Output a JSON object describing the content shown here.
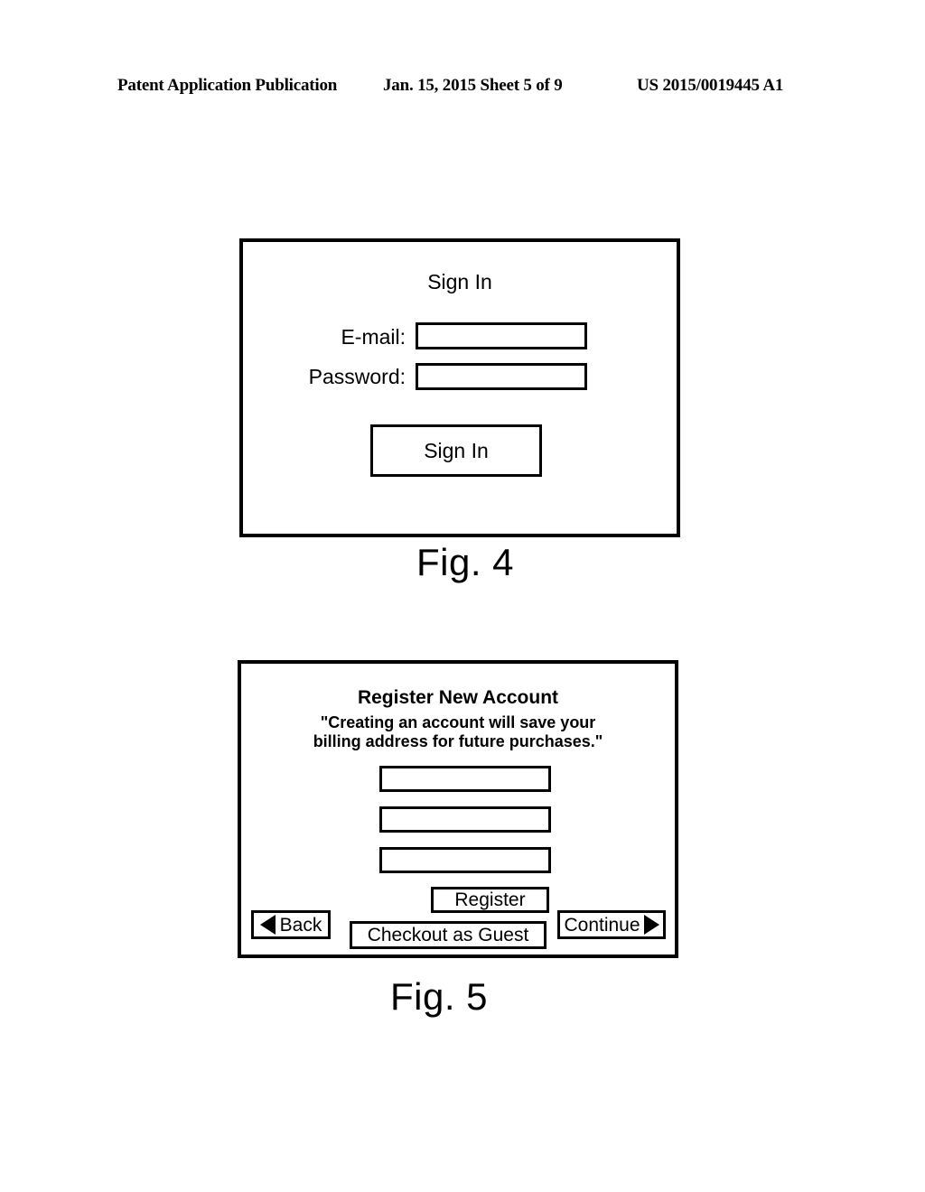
{
  "header": {
    "publication": "Patent Application Publication",
    "date_sheet": "Jan. 15, 2015  Sheet 5 of 9",
    "document_number": "US 2015/0019445 A1"
  },
  "figures": [
    {
      "caption": "Fig. 4",
      "screen_title": "Sign In",
      "labels": {
        "email": "E-mail:",
        "password": "Password:"
      },
      "fields": [
        {
          "name": "email",
          "value": "",
          "placeholder": ""
        },
        {
          "name": "password",
          "value": "",
          "placeholder": ""
        }
      ],
      "buttons": {
        "sign_in": "Sign In"
      }
    },
    {
      "caption": "Fig. 5",
      "screen_title": "Register New Account",
      "subtitle_line_1": "\"Creating an account will save your",
      "subtitle_line_2": "billing address for future purchases.\"",
      "fields": [
        {
          "name": "field-1",
          "value": "",
          "placeholder": ""
        },
        {
          "name": "field-2",
          "value": "",
          "placeholder": ""
        },
        {
          "name": "field-3",
          "value": "",
          "placeholder": ""
        }
      ],
      "buttons": {
        "register": "Register",
        "checkout_as_guest": "Checkout as Guest",
        "back": "Back",
        "continue": "Continue"
      },
      "icons": {
        "back_arrow": "triangle-left-icon",
        "continue_arrow": "triangle-right-icon"
      }
    }
  ],
  "colors": {
    "ink": "#000000",
    "paper": "#ffffff"
  }
}
